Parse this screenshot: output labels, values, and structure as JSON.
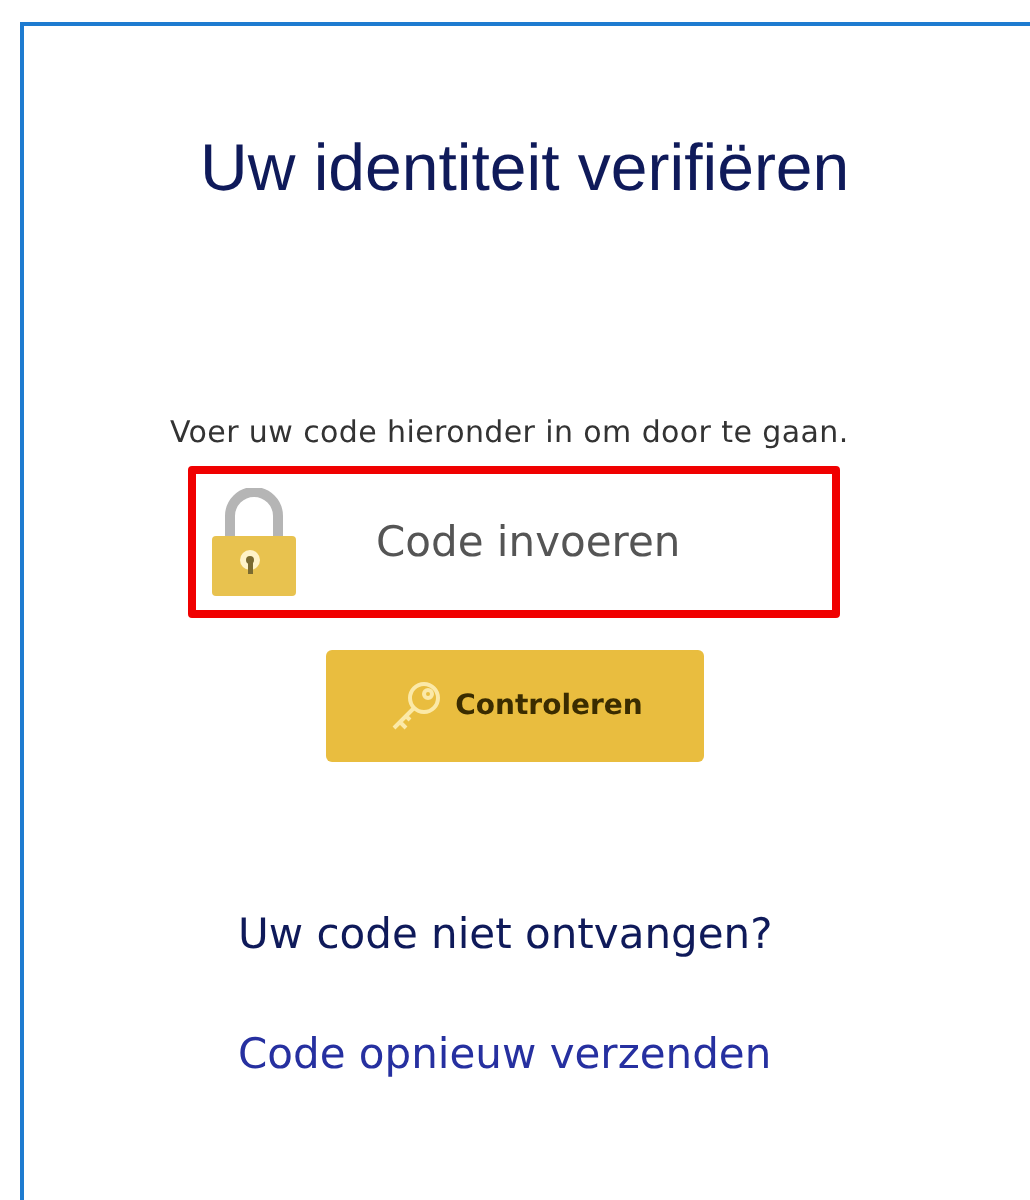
{
  "title": "Uw identiteit verifiëren",
  "instruction": "Voer uw code hieronder in om door te gaan.",
  "code_field": {
    "placeholder": "Code invoeren",
    "highlighted": true
  },
  "submit_button": {
    "label": "Controleren"
  },
  "resend_prompt": "Uw code niet ontvangen?",
  "resend_link": "Code opnieuw verzenden"
}
